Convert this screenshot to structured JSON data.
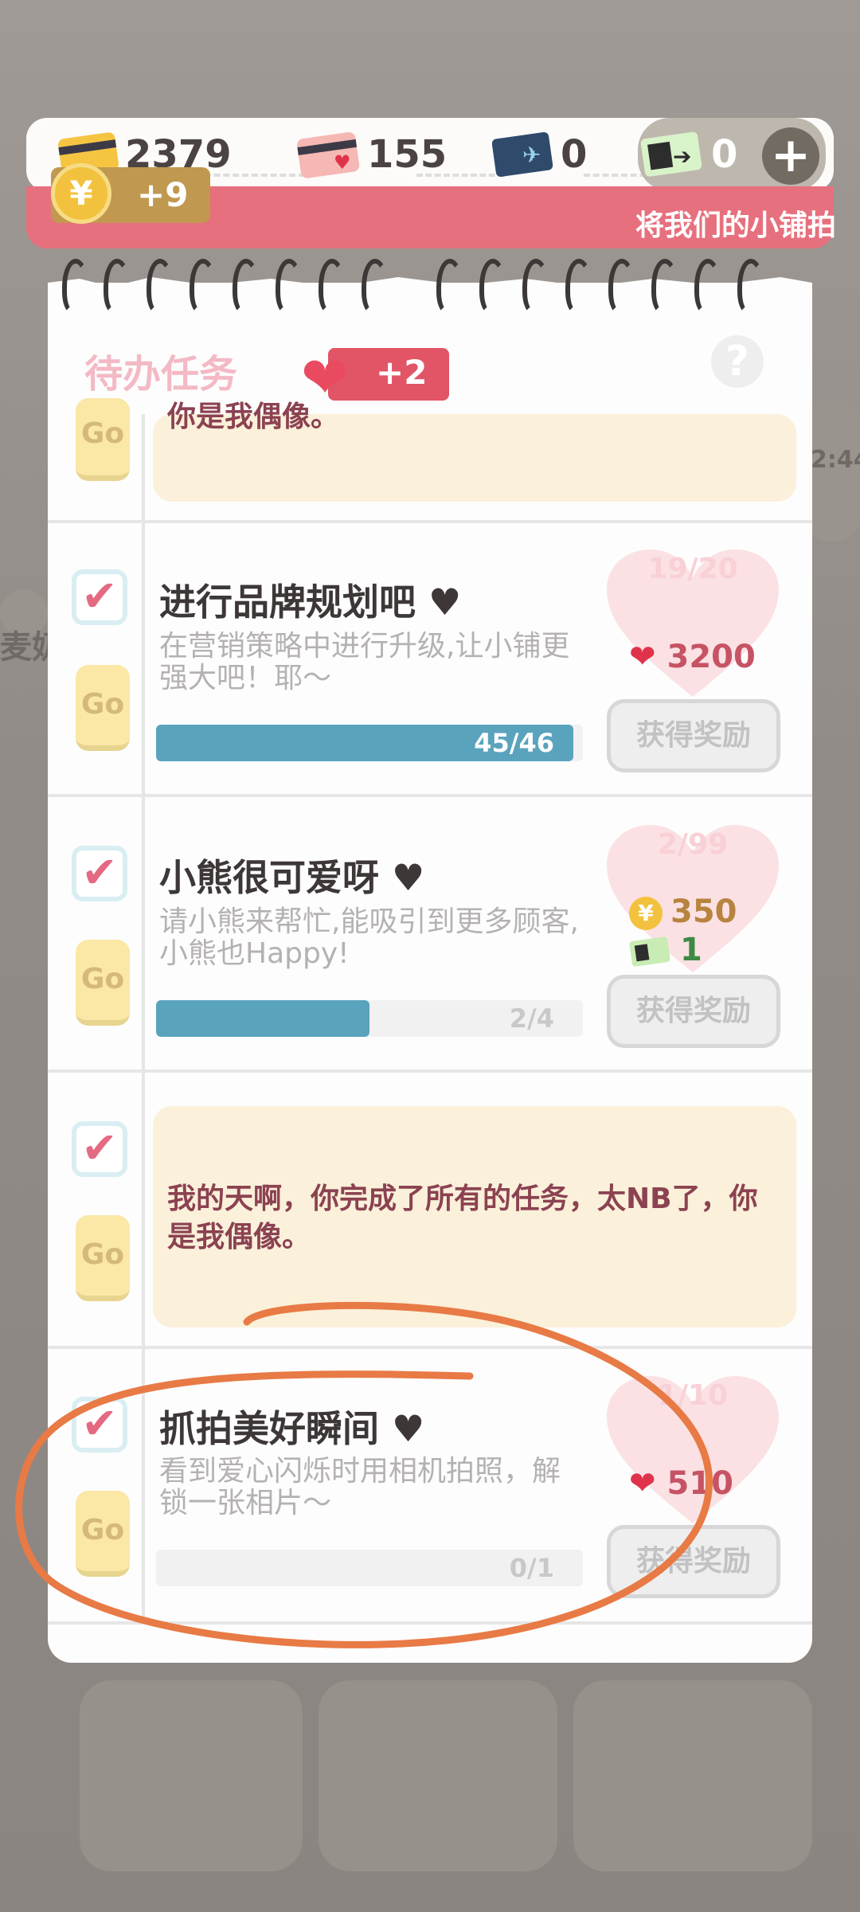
{
  "currencies": [
    {
      "icon": "gold-card-icon",
      "value": "2379"
    },
    {
      "icon": "pink-heart-card-icon",
      "value": "155"
    },
    {
      "icon": "blue-plane-ticket-icon",
      "value": "0"
    },
    {
      "icon": "green-ticket-icon",
      "value": "0"
    }
  ],
  "coin_popup": {
    "symbol": "¥",
    "text": "+9"
  },
  "marquee_text": "将我们的小铺拍",
  "background_text": [
    "2:44",
    "麦奶"
  ],
  "panel": {
    "title": "待办任务",
    "heart_bonus": "+2",
    "help": "?"
  },
  "tasks": [
    {
      "type": "message",
      "go_label": "Go",
      "message": "你是我偶像。"
    },
    {
      "type": "task",
      "check": "✔",
      "go_label": "Go",
      "title": "进行品牌规划吧 ♥",
      "desc": "在营销策略中进行升级,让小铺更强大吧！耶～",
      "progress_text": "45/46",
      "progress": 0.978,
      "count": "19/20",
      "rewards": [
        {
          "icon": "heart-icon",
          "value": "3200"
        }
      ],
      "claim_label": "获得奖励"
    },
    {
      "type": "task",
      "check": "✔",
      "go_label": "Go",
      "title": "小熊很可爱呀 ♥",
      "desc": "请小熊来帮忙,能吸引到更多顾客,小熊也Happy!",
      "progress_text": "2/4",
      "progress": 0.5,
      "count": "2/99",
      "rewards": [
        {
          "icon": "coin-icon",
          "symbol": "¥",
          "value": "350"
        },
        {
          "icon": "green-ticket-icon",
          "value": "1"
        }
      ],
      "claim_label": "获得奖励"
    },
    {
      "type": "message",
      "check": "✔",
      "go_label": "Go",
      "message": "我的天啊，你完成了所有的任务，太NB了，你是我偶像。"
    },
    {
      "type": "task",
      "check": "✔",
      "go_label": "Go",
      "title": "抓拍美好瞬间 ♥",
      "desc": "看到爱心闪烁时用相机拍照，解锁一张相片～",
      "progress_text": "0/1",
      "progress": 0,
      "count": "1/10",
      "rewards": [
        {
          "icon": "heart-icon",
          "value": "510"
        }
      ],
      "claim_label": "获得奖励"
    }
  ],
  "colors": {
    "accent_pink": "#e7707e",
    "progress_blue": "#5aa3bd",
    "annotation_orange": "#e87a45"
  }
}
